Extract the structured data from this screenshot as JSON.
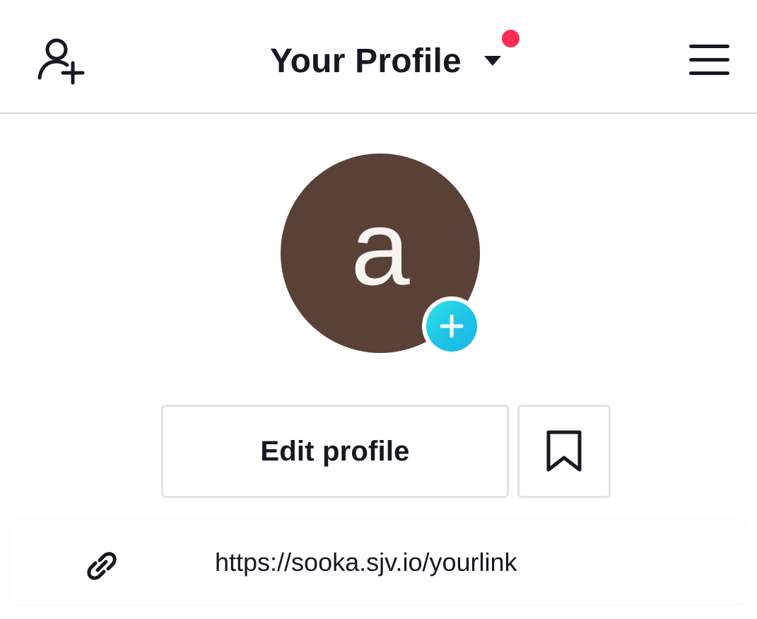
{
  "header": {
    "title": "Your Profile",
    "add_user_icon": "add-user-icon",
    "dropdown_icon": "caret-down-icon",
    "menu_icon": "hamburger-menu-icon",
    "notification_dot_color": "#fe2c55"
  },
  "profile": {
    "avatar_letter": "a",
    "avatar_color": "#5a4138",
    "avatar_add_icon": "plus-icon"
  },
  "actions": {
    "edit_profile_label": "Edit profile",
    "bookmark_icon": "bookmark-icon"
  },
  "bio_link": {
    "icon": "link-icon",
    "url": "https://sooka.sjv.io/yourlink"
  }
}
